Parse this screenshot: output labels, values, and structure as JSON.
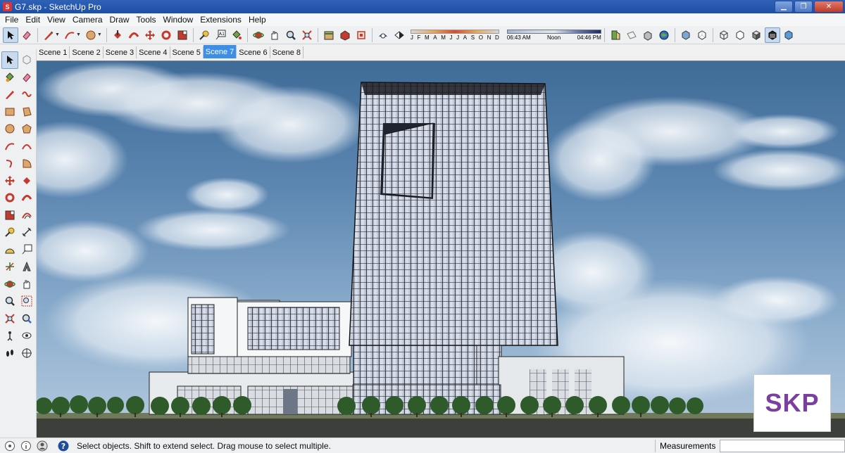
{
  "window": {
    "title": "G7.skp - SketchUp Pro",
    "app_icon": "sketchup-logo-icon"
  },
  "menu": [
    "File",
    "Edit",
    "View",
    "Camera",
    "Draw",
    "Tools",
    "Window",
    "Extensions",
    "Help"
  ],
  "shadow_settings": {
    "months": [
      "J",
      "F",
      "M",
      "A",
      "M",
      "J",
      "J",
      "A",
      "S",
      "O",
      "N",
      "D"
    ],
    "time_start": "06:43 AM",
    "time_mid": "Noon",
    "time_end": "04:46 PM"
  },
  "scenes": {
    "tabs": [
      "Scene 1",
      "Scene 2",
      "Scene 3",
      "Scene 4",
      "Scene 5",
      "Scene 7",
      "Scene 6",
      "Scene 8"
    ],
    "active": "Scene 7"
  },
  "viewport": {
    "watermark": "SKP"
  },
  "status": {
    "message": "Select objects. Shift to extend select. Drag mouse to select multiple.",
    "measurements_label": "Measurements",
    "measurements_value": ""
  },
  "colors": {
    "title_bar": "#1e4fa8",
    "active_tab": "#3d8ee6",
    "watermark_text": "#7b3fa0"
  }
}
